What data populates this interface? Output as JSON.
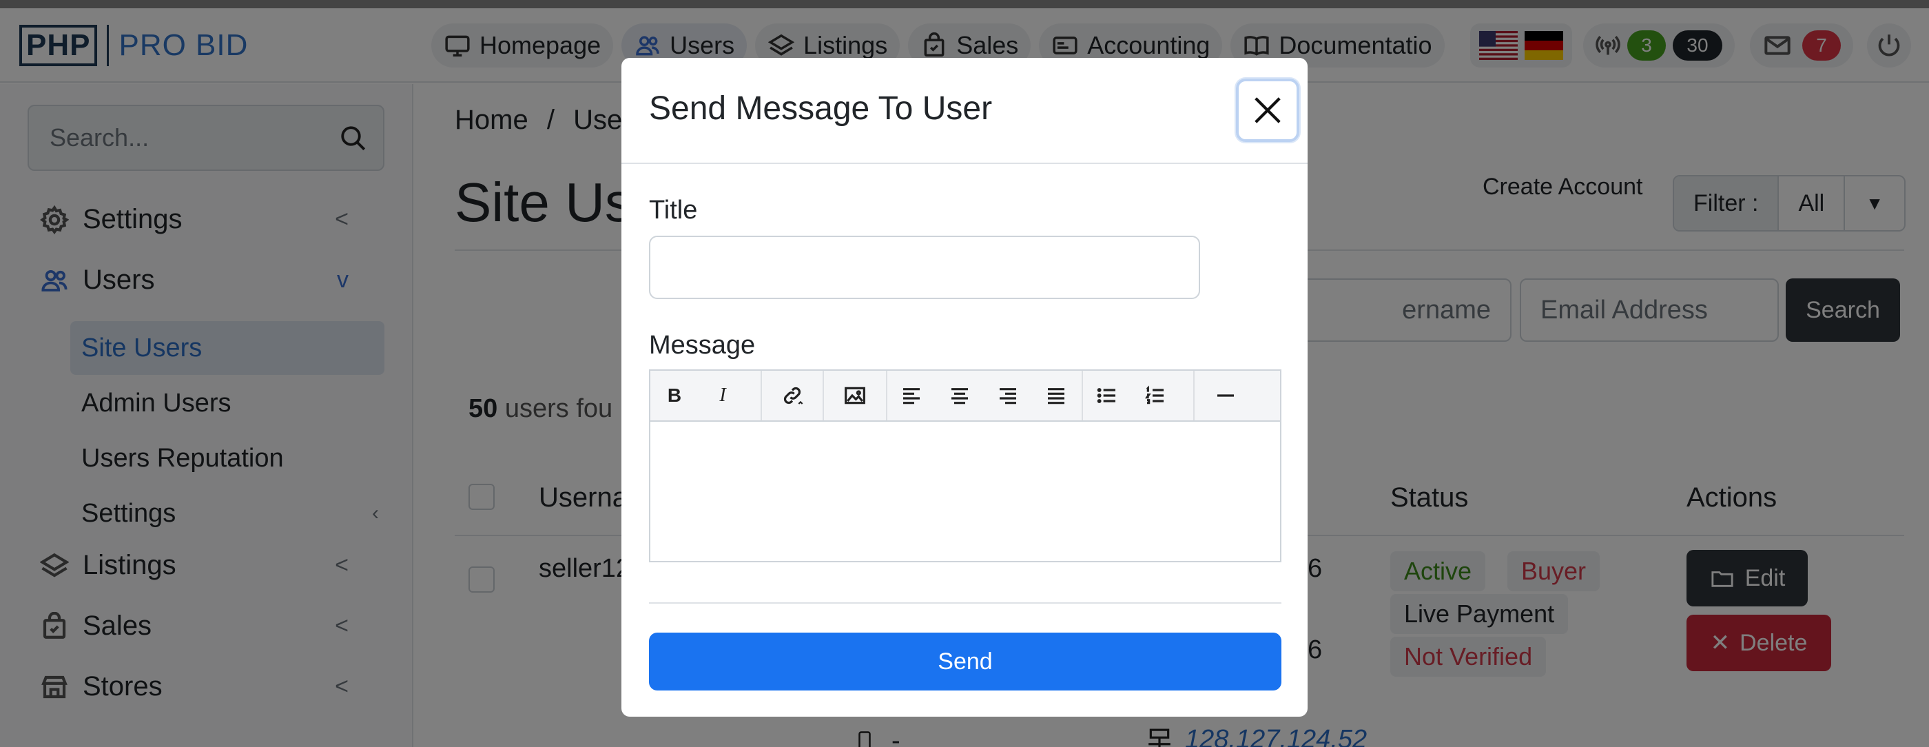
{
  "brand": {
    "php": "PHP",
    "pro_bid": "PRO BID"
  },
  "nav": {
    "tabs": [
      {
        "label": "Homepage",
        "icon": "monitor-icon"
      },
      {
        "label": "Users",
        "icon": "users-icon"
      },
      {
        "label": "Listings",
        "icon": "layers-icon"
      },
      {
        "label": "Sales",
        "icon": "bag-icon"
      },
      {
        "label": "Accounting",
        "icon": "card-icon"
      },
      {
        "label": "Documentatio",
        "icon": "book-icon"
      }
    ],
    "notify_green": "3",
    "notify_dark": "30",
    "mail_count": "7"
  },
  "sidebar": {
    "search_placeholder": "Search...",
    "items": [
      {
        "label": "Settings",
        "chevron": "<"
      },
      {
        "label": "Users",
        "chevron": "v"
      },
      {
        "label": "Listings",
        "chevron": "<"
      },
      {
        "label": "Sales",
        "chevron": "<"
      },
      {
        "label": "Stores",
        "chevron": "<"
      }
    ],
    "sub_items": [
      {
        "label": "Site Users"
      },
      {
        "label": "Admin Users"
      },
      {
        "label": "Users Reputation"
      },
      {
        "label": "Settings"
      }
    ]
  },
  "main": {
    "breadcrumb_home": "Home",
    "breadcrumb_sep": "/",
    "breadcrumb_current": "User",
    "page_title": "Site Us",
    "create_account": "Create Account",
    "filter_label": "Filter :",
    "filter_value": "All",
    "username_placeholder": "ername",
    "email_placeholder": "Email Address",
    "search_button": "Search",
    "users_count": "50",
    "users_found": "users fou",
    "headers": {
      "username": "Userna",
      "status": "Status",
      "actions": "Actions"
    },
    "row": {
      "username": "seller12",
      "reg_digit_1": "6",
      "reg_digit_2": "6",
      "phone": "-",
      "ip": "128.127.124.52",
      "tags": {
        "active": "Active",
        "buyer": "Buyer",
        "live_payment": "Live Payment",
        "not_verified": "Not Verified"
      },
      "edit_label": "Edit",
      "delete_label": "Delete"
    }
  },
  "modal": {
    "title": "Send Message To User",
    "title_label": "Title",
    "title_value": "",
    "message_label": "Message",
    "message_value": "",
    "toolbar": [
      "bold",
      "italic",
      "link",
      "image",
      "align-left",
      "align-center",
      "align-right",
      "align-justify",
      "bullet-list",
      "numbered-list",
      "horizontal-rule"
    ],
    "toolbar_bold": "B",
    "toolbar_italic": "I",
    "send_label": "Send"
  },
  "colors": {
    "primary": "#1a73f0",
    "dark": "#2f353b",
    "danger": "#c8283a",
    "success_text": "#3d8b1a",
    "danger_text": "#d03a4a",
    "badge_green": "#47a11e",
    "badge_dark": "#1f242b",
    "badge_red": "#dc3545"
  }
}
